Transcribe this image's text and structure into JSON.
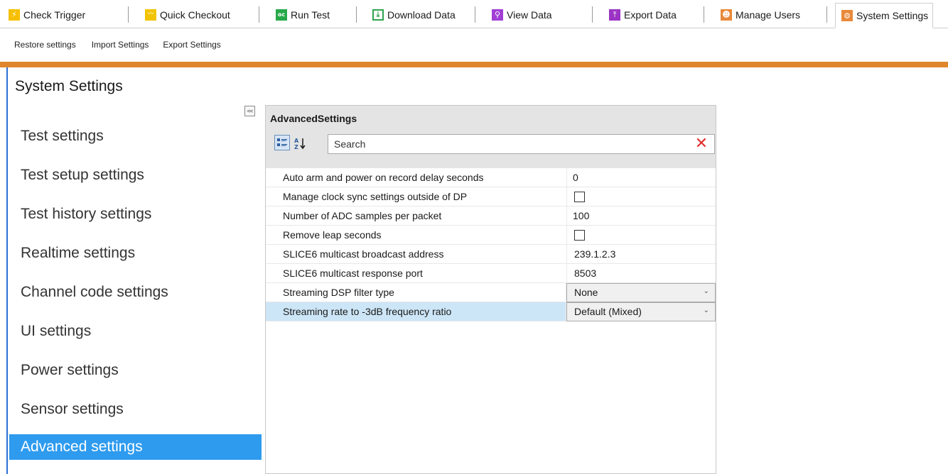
{
  "tabs": [
    {
      "label": "Check Trigger",
      "icon": "trigger-icon"
    },
    {
      "label": "Quick Checkout",
      "icon": "quick-checkout-icon"
    },
    {
      "label": "Run Test",
      "icon": "run-test-icon"
    },
    {
      "label": "Download Data",
      "icon": "download-icon"
    },
    {
      "label": "View Data",
      "icon": "view-data-icon"
    },
    {
      "label": "Export Data",
      "icon": "export-icon"
    },
    {
      "label": "Manage Users",
      "icon": "users-icon"
    },
    {
      "label": "System Settings",
      "icon": "settings-icon"
    }
  ],
  "menu": {
    "restore": "Restore settings",
    "import": "Import Settings",
    "export": "Export Settings"
  },
  "page_title": "System Settings",
  "collapse_glyph": "<<",
  "sidebar": [
    {
      "label": "Test settings"
    },
    {
      "label": "Test setup settings"
    },
    {
      "label": "Test history settings"
    },
    {
      "label": "Realtime settings"
    },
    {
      "label": "Channel code settings"
    },
    {
      "label": "UI settings"
    },
    {
      "label": "Power settings"
    },
    {
      "label": "Sensor settings"
    },
    {
      "label": "Advanced settings",
      "selected": true
    }
  ],
  "property_grid": {
    "title": "AdvancedSettings",
    "search_placeholder": "Search",
    "sort_glyph": "A Z",
    "clear_glyph": "✕",
    "rows": [
      {
        "name": "Auto arm and power on record delay seconds",
        "value": "0",
        "kind": "text"
      },
      {
        "name": "Manage clock sync settings outside of DP",
        "value": "",
        "kind": "checkbox",
        "checked": false
      },
      {
        "name": "Number of ADC samples per packet",
        "value": "100",
        "kind": "text"
      },
      {
        "name": "Remove leap seconds",
        "value": "",
        "kind": "checkbox",
        "checked": false
      },
      {
        "name": "SLICE6 multicast broadcast address",
        "value": "239.1.2.3",
        "kind": "text"
      },
      {
        "name": "SLICE6 multicast response port",
        "value": "8503",
        "kind": "text"
      },
      {
        "name": "Streaming DSP filter type",
        "value": "None",
        "kind": "combo"
      },
      {
        "name": "Streaming rate to -3dB frequency ratio",
        "value": "Default (Mixed)",
        "kind": "combo",
        "selected": true
      }
    ]
  },
  "colors": {
    "accent_orange": "#e0872d",
    "selection_blue": "#2e9bef",
    "row_selected": "#cde6f7",
    "frame_blue": "#2b6fd6"
  }
}
